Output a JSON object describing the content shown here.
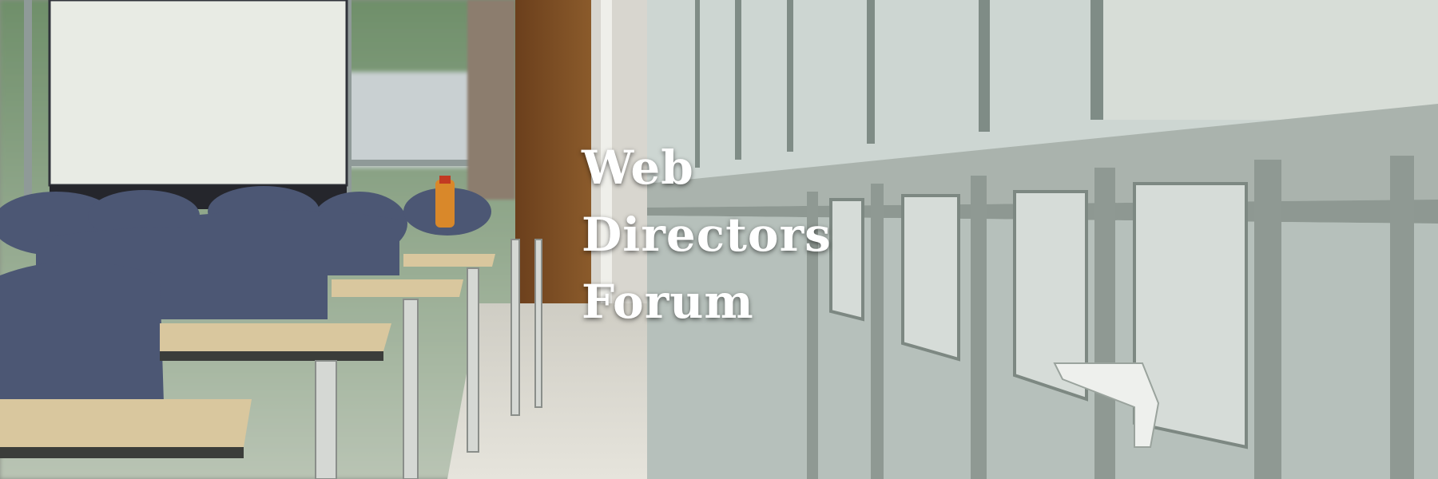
{
  "banner": {
    "title_lines": [
      "Web",
      "Directors",
      "Forum"
    ]
  },
  "palette": {
    "screen": "#e8ebe4",
    "chair": "#4c5774",
    "desk": "#d9c79e",
    "frame": "#a9b1aa",
    "wall": "#7a4a22",
    "floor": "#c9c8c2"
  }
}
